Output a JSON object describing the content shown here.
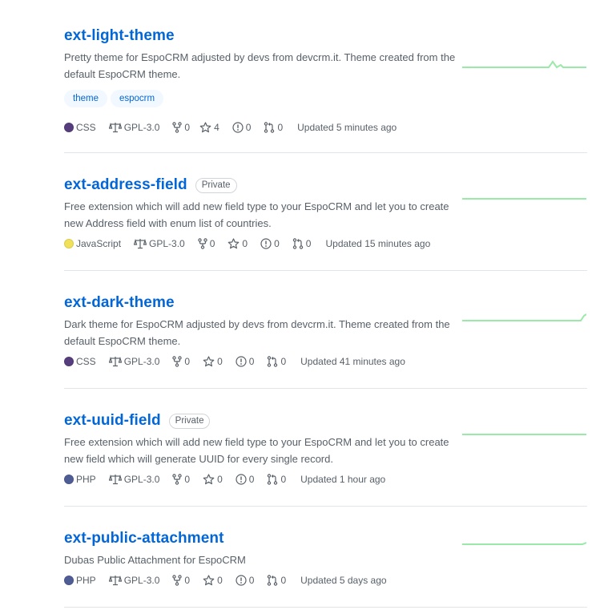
{
  "colors": {
    "link": "#0366d6",
    "spark": "#9be9a8",
    "css": "#563d7c",
    "javascript": "#f1e05a",
    "php": "#4F5D95"
  },
  "repos": [
    {
      "name": "ext-light-theme",
      "private": "",
      "description": "Pretty theme for EspoCRM adjusted by devs from devcrm.it. Theme created from the default EspoCRM theme.",
      "topics": [
        "theme",
        "espocrm"
      ],
      "language": "CSS",
      "lang_color": "#563d7c",
      "license": "GPL-3.0",
      "forks": "0",
      "stars": "4",
      "issues": "0",
      "prs": "0",
      "updated": "Updated 5 minutes ago"
    },
    {
      "name": "ext-address-field",
      "private": "Private",
      "description": "Free extension which will add new field type to your EspoCRM and let you to create new Address field with enum list of countries.",
      "topics": [],
      "language": "JavaScript",
      "lang_color": "#f1e05a",
      "license": "GPL-3.0",
      "forks": "0",
      "stars": "0",
      "issues": "0",
      "prs": "0",
      "updated": "Updated 15 minutes ago"
    },
    {
      "name": "ext-dark-theme",
      "private": "",
      "description": "Dark theme for EspoCRM adjusted by devs from devcrm.it. Theme created from the default EspoCRM theme.",
      "topics": [],
      "language": "CSS",
      "lang_color": "#563d7c",
      "license": "GPL-3.0",
      "forks": "0",
      "stars": "0",
      "issues": "0",
      "prs": "0",
      "updated": "Updated 41 minutes ago"
    },
    {
      "name": "ext-uuid-field",
      "private": "Private",
      "description": "Free extension which will add new field type to your EspoCRM and let you to create new field which will generate UUID for every single record.",
      "topics": [],
      "language": "PHP",
      "lang_color": "#4F5D95",
      "license": "GPL-3.0",
      "forks": "0",
      "stars": "0",
      "issues": "0",
      "prs": "0",
      "updated": "Updated 1 hour ago"
    },
    {
      "name": "ext-public-attachment",
      "private": "",
      "description": "Dubas Public Attachment for EspoCRM",
      "topics": [],
      "language": "PHP",
      "lang_color": "#4F5D95",
      "license": "GPL-3.0",
      "forks": "0",
      "stars": "0",
      "issues": "0",
      "prs": "0",
      "updated": "Updated 5 days ago"
    }
  ]
}
